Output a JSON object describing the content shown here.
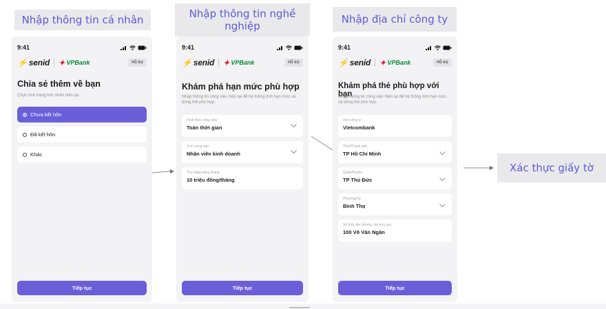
{
  "labels": {
    "personal": "Nhập thông tin cá nhân",
    "job": "Nhập thông tin nghề nghiệp",
    "address": "Nhập địa chỉ công ty",
    "verify": "Xác thực giấy tờ"
  },
  "status": {
    "time": "9:41"
  },
  "brand": {
    "senid": "senid",
    "vpbank": "VPBank",
    "help": "Hỗ trợ"
  },
  "screen1": {
    "title": "Chia sẻ thêm về bạn",
    "subtitle": "Chọn tình trạng hôn nhân hiện tại.",
    "options": [
      "Chưa kết hôn",
      "Đã kết hôn",
      "Khác"
    ],
    "selected_index": 0,
    "cta": "Tiếp tục"
  },
  "screen2": {
    "title": "Khám phá hạn mức phù hợp",
    "subtitle": "Nhập thông tin công việc hiện tại để hệ thống tính hạn mức và dòng thẻ phù hợp.",
    "fields": [
      {
        "label": "Hình thức công việc",
        "value": "Toàn thời gian"
      },
      {
        "label": "Vị trí công việc",
        "value": "Nhân viên kinh doanh"
      },
      {
        "label": "Thu nhập hàng tháng",
        "value": "10 triệu đồng/tháng"
      }
    ],
    "cta": "Tiếp tục"
  },
  "screen3": {
    "title": "Khám phá thẻ phù hợp với bạn",
    "subtitle": "Nhập thông tin công việc hiện tại để hệ thống tính hạn mức và dòng thẻ phù hợp.",
    "fields": [
      {
        "label": "Tên công ty",
        "value": "Vietcombank"
      },
      {
        "label": "Tỉnh/Thành phố",
        "value": "TP Hồ Chí Minh"
      },
      {
        "label": "Quận/Huyện",
        "value": "TP Thủ Đức"
      },
      {
        "label": "Phường/Xã",
        "value": "Bình Thọ"
      },
      {
        "label": "Số nhà, tên đường, tên khu vực",
        "value": "100 Võ Văn Ngân"
      }
    ],
    "cta": "Tiếp tục"
  },
  "colors": {
    "accent": "#6a5ed9",
    "label_text": "#5b5bd6",
    "label_bg": "#e9e9ec"
  }
}
